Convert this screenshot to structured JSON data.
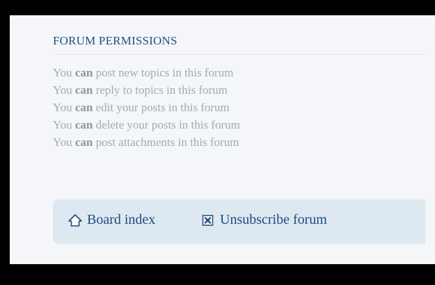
{
  "permissions": {
    "title": "FORUM PERMISSIONS",
    "items": [
      {
        "prefix": "You",
        "verb": "can",
        "rest": "post new topics in this forum"
      },
      {
        "prefix": "You",
        "verb": "can",
        "rest": "reply to topics in this forum"
      },
      {
        "prefix": "You",
        "verb": "can",
        "rest": "edit your posts in this forum"
      },
      {
        "prefix": "You",
        "verb": "can",
        "rest": "delete your posts in this forum"
      },
      {
        "prefix": "You",
        "verb": "can",
        "rest": "post attachments in this forum"
      }
    ]
  },
  "navbar": {
    "board_index_label": "Board index",
    "board_index_icon": "home-icon",
    "unsubscribe_label": "Unsubscribe forum",
    "unsubscribe_icon": "unsubscribe-icon"
  },
  "colors": {
    "title": "#1f4e87",
    "permission_text": "#a2aab6",
    "navbar_bg": "#dde8f1",
    "link": "#1e4b7e"
  }
}
